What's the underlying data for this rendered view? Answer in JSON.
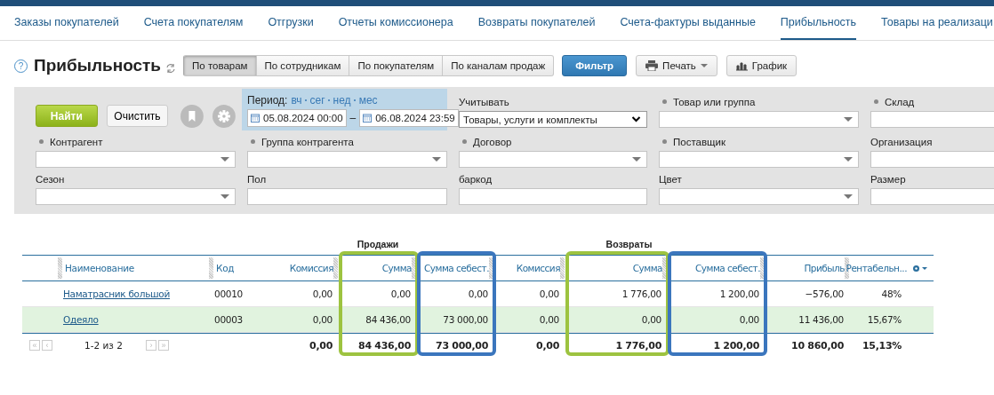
{
  "top_tabs": [
    {
      "label": "Заказы покупателей",
      "selected": false
    },
    {
      "label": "Счета покупателям",
      "selected": false
    },
    {
      "label": "Отгрузки",
      "selected": false
    },
    {
      "label": "Отчеты комиссионера",
      "selected": false
    },
    {
      "label": "Возвраты покупателей",
      "selected": false
    },
    {
      "label": "Счета-фактуры выданные",
      "selected": false
    },
    {
      "label": "Прибыльность",
      "selected": true
    },
    {
      "label": "Товары на реализаци",
      "selected": false
    }
  ],
  "help": "?",
  "title": "Прибыльность",
  "view_tabs": [
    {
      "label": "По товарам",
      "selected": true
    },
    {
      "label": "По сотрудникам",
      "selected": false
    },
    {
      "label": "По покупателям",
      "selected": false
    },
    {
      "label": "По каналам продаж",
      "selected": false
    }
  ],
  "toolbar": {
    "filter": "Фильтр",
    "print": "Печать",
    "chart": "График"
  },
  "filters": {
    "find": "Найти",
    "clear": "Очистить",
    "period": {
      "label": "Период:",
      "shortcuts": [
        "вч",
        "сег",
        "нед",
        "мес"
      ],
      "separator": "–",
      "from": "05.08.2024 00:00",
      "to": "06.08.2024 23:59"
    },
    "fields": [
      {
        "kind": "select",
        "label": "Учитывать",
        "dot": false,
        "value": "Товары, услуги и комплекты"
      },
      {
        "kind": "combo",
        "label": "Товар или группа",
        "dot": true
      },
      {
        "kind": "input",
        "label": "Склад",
        "dot": true
      },
      {
        "kind": "combo",
        "label": "Контрагент",
        "dot": true
      },
      {
        "kind": "combo",
        "label": "Группа контрагента",
        "dot": true
      },
      {
        "kind": "combo",
        "label": "Договор",
        "dot": true
      },
      {
        "kind": "combo",
        "label": "Поставщик",
        "dot": true
      },
      {
        "kind": "input",
        "label": "Организация",
        "dot": false
      },
      {
        "kind": "combo",
        "label": "Сезон",
        "dot": false
      },
      {
        "kind": "input",
        "label": "Пол",
        "dot": false
      },
      {
        "kind": "input",
        "label": "баркод",
        "dot": false
      },
      {
        "kind": "combo",
        "label": "Цвет",
        "dot": false
      },
      {
        "kind": "input",
        "label": "Размер",
        "dot": false
      }
    ]
  },
  "table": {
    "groups": [
      {
        "label": "Продажи"
      },
      {
        "label": "Возвраты"
      }
    ],
    "columns": [
      {
        "label": "Наименование"
      },
      {
        "label": "Код"
      },
      {
        "label": "Комиссия"
      },
      {
        "label": "Сумма",
        "color": "#9dc340"
      },
      {
        "label": "Сумма себест.",
        "color": "#3b76bd"
      },
      {
        "label": "Комиссия"
      },
      {
        "label": "Сумма",
        "color": "#9dc340"
      },
      {
        "label": "Сумма себест.",
        "color": "#3b76bd"
      },
      {
        "label": "Прибыль"
      },
      {
        "label": "Рентабельн..."
      }
    ],
    "rows": [
      {
        "selected": false,
        "cells": [
          "Наматрасник большой",
          "00010",
          "0,00",
          "0,00",
          "0,00",
          "0,00",
          "1 776,00",
          "1 200,00",
          "−576,00",
          "48%"
        ]
      },
      {
        "selected": true,
        "cells": [
          "Одеяло",
          "00003",
          "0,00",
          "84 436,00",
          "73 000,00",
          "0,00",
          "0,00",
          "0,00",
          "11 436,00",
          "15,67%"
        ]
      }
    ],
    "pager": {
      "first": "«",
      "prev": "‹",
      "status": "1-2 из 2",
      "next": "›",
      "last": "»"
    },
    "totals": [
      "0,00",
      "84 436,00",
      "73 000,00",
      "0,00",
      "1 776,00",
      "1 200,00",
      "10 860,00",
      "15,13%"
    ]
  }
}
